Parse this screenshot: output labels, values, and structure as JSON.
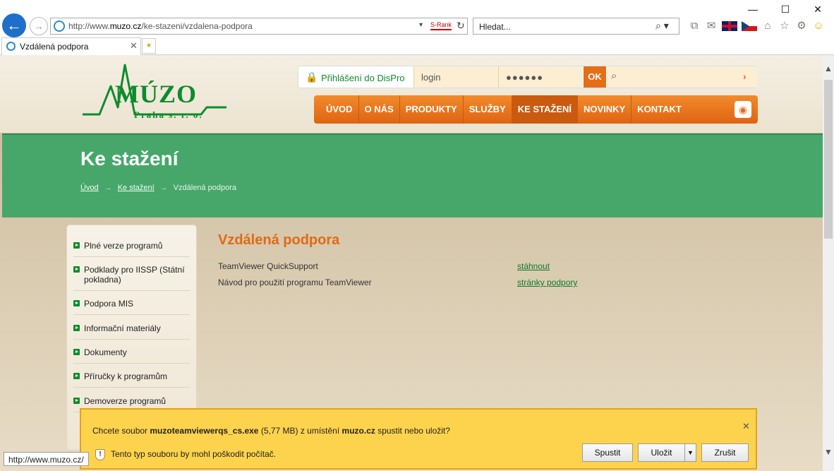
{
  "browser": {
    "url_prefix": "http://www.",
    "url_domain": "muzo.cz",
    "url_path": "/ke-stazeni/vzdalena-podpora",
    "srank_label": "S-Rank",
    "search_placeholder": "Hledat...",
    "tab_title": "Vzdálená podpora"
  },
  "header": {
    "brand": "MÚZO",
    "brand_sub": "Praha s. r. o.",
    "login_label": "Přihlášení do DisPro",
    "login_placeholder": "login",
    "password_value": "●●●●●●",
    "ok_label": "OK"
  },
  "nav": {
    "items": [
      "ÚVOD",
      "O NÁS",
      "PRODUKTY",
      "SLUŽBY",
      "KE STAŽENÍ",
      "NOVINKY",
      "KONTAKT"
    ],
    "active_index": 4
  },
  "banner": {
    "title": "Ke stažení",
    "breadcrumb": [
      "Úvod",
      "Ke stažení",
      "Vzdálená podpora"
    ]
  },
  "sidebar": {
    "items": [
      "Plné verze programů",
      "Podklady pro IISSP (Státní pokladna)",
      "Podpora MIS",
      "Informační materiály",
      "Dokumenty",
      "Příručky k programům",
      "Demoverze programů"
    ]
  },
  "content": {
    "title": "Vzdálená podpora",
    "rows": [
      {
        "label": "TeamViewer QuickSupport",
        "link": "stáhnout"
      },
      {
        "label": "Návod pro použití programu TeamViewer",
        "link": "stránky podpory"
      }
    ]
  },
  "status_url": "http://www.muzo.cz/",
  "download_bar": {
    "q_prefix": "Chcete soubor ",
    "filename": "muzoteamviewerqs_cs.exe",
    "q_middle": " (5,77 MB) z umístění ",
    "source": "muzo.cz",
    "q_suffix": " spustit nebo uložit?",
    "warning": "Tento typ souboru by mohl poškodit počítač.",
    "run_label": "Spustit",
    "save_label": "Uložit",
    "cancel_label": "Zrušit"
  }
}
